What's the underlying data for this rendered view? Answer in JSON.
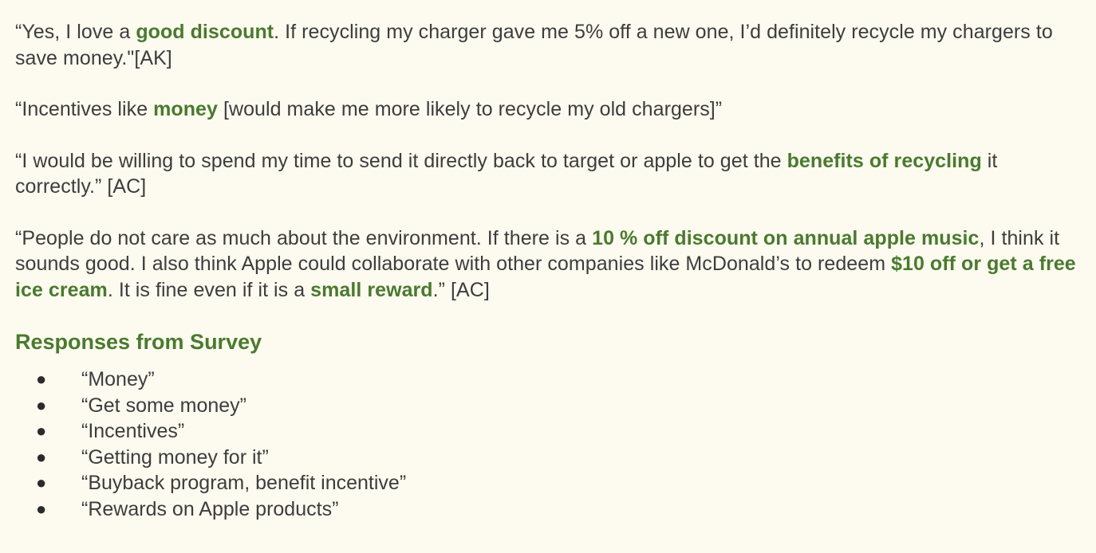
{
  "quotes": [
    {
      "parts": [
        {
          "text": "“Yes, I love a ",
          "bold": false
        },
        {
          "text": "good discount",
          "bold": true
        },
        {
          "text": ". If recycling my charger gave me 5% off a new one, I’d definitely recycle my chargers to save money.\"[AK]",
          "bold": false
        }
      ]
    },
    {
      "parts": [
        {
          "text": "“Incentives like ",
          "bold": false
        },
        {
          "text": "money",
          "bold": true
        },
        {
          "text": " [would make me more likely to recycle my old chargers]”",
          "bold": false
        }
      ]
    },
    {
      "parts": [
        {
          "text": "“I would be willing to spend my time to send it directly back to target or apple to get the ",
          "bold": false
        },
        {
          "text": "benefits of recycling",
          "bold": true
        },
        {
          "text": " it correctly.” [AC]",
          "bold": false
        }
      ]
    },
    {
      "parts": [
        {
          "text": "“People do not care as much about the environment. If there is a ",
          "bold": false
        },
        {
          "text": "10 % off discount on annual apple music",
          "bold": true
        },
        {
          "text": ", I think it sounds good. I also think Apple could collaborate with other companies like McDonald’s to redeem ",
          "bold": false
        },
        {
          "text": "$10 off or get a free ice cream",
          "bold": true
        },
        {
          "text": ". It is fine even if it is a ",
          "bold": false
        },
        {
          "text": "small reward",
          "bold": true
        },
        {
          "text": ".” [AC]",
          "bold": false
        }
      ]
    }
  ],
  "survey": {
    "heading": "Responses from Survey",
    "bullet": "●",
    "items": [
      "“Money”",
      "“Get some money”",
      "“Incentives”",
      "“Getting money for it”",
      "“Buyback program, benefit incentive”",
      "“Rewards on Apple products”"
    ]
  },
  "colors": {
    "background": "#fdfaf0",
    "text": "#3d3d3d",
    "accent": "#4a7a2e"
  }
}
